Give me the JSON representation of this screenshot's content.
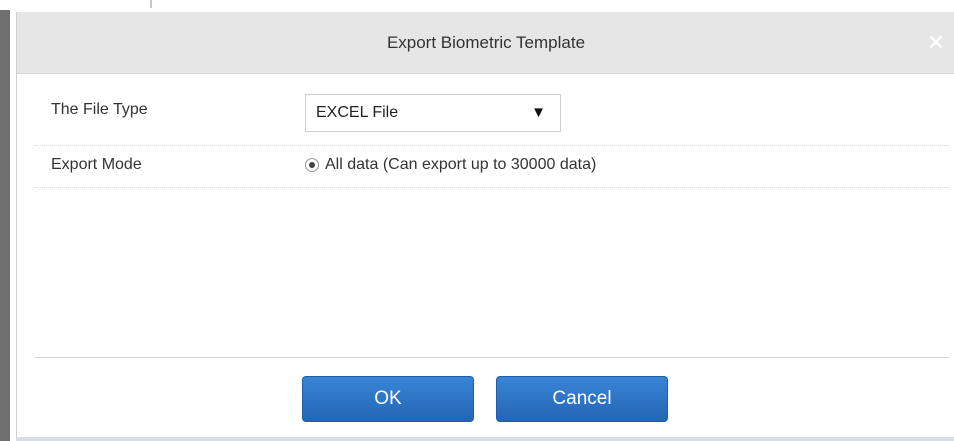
{
  "dialog": {
    "title": "Export Biometric Template",
    "close_symbol": "✕"
  },
  "form": {
    "file_type": {
      "label": "The File Type",
      "selected": "EXCEL File",
      "arrow": "▼"
    },
    "export_mode": {
      "label": "Export Mode",
      "option": "All data (Can export up to 30000 data)",
      "checked": true
    }
  },
  "buttons": {
    "ok_label": "OK",
    "cancel_label": "Cancel"
  },
  "icons": {
    "close": "close-icon",
    "dropdown": "dropdown-arrow-icon",
    "radio": "radio-selected-icon"
  },
  "colors": {
    "titlebar": "#e6e6e6",
    "button_primary": "#2f76c7"
  }
}
